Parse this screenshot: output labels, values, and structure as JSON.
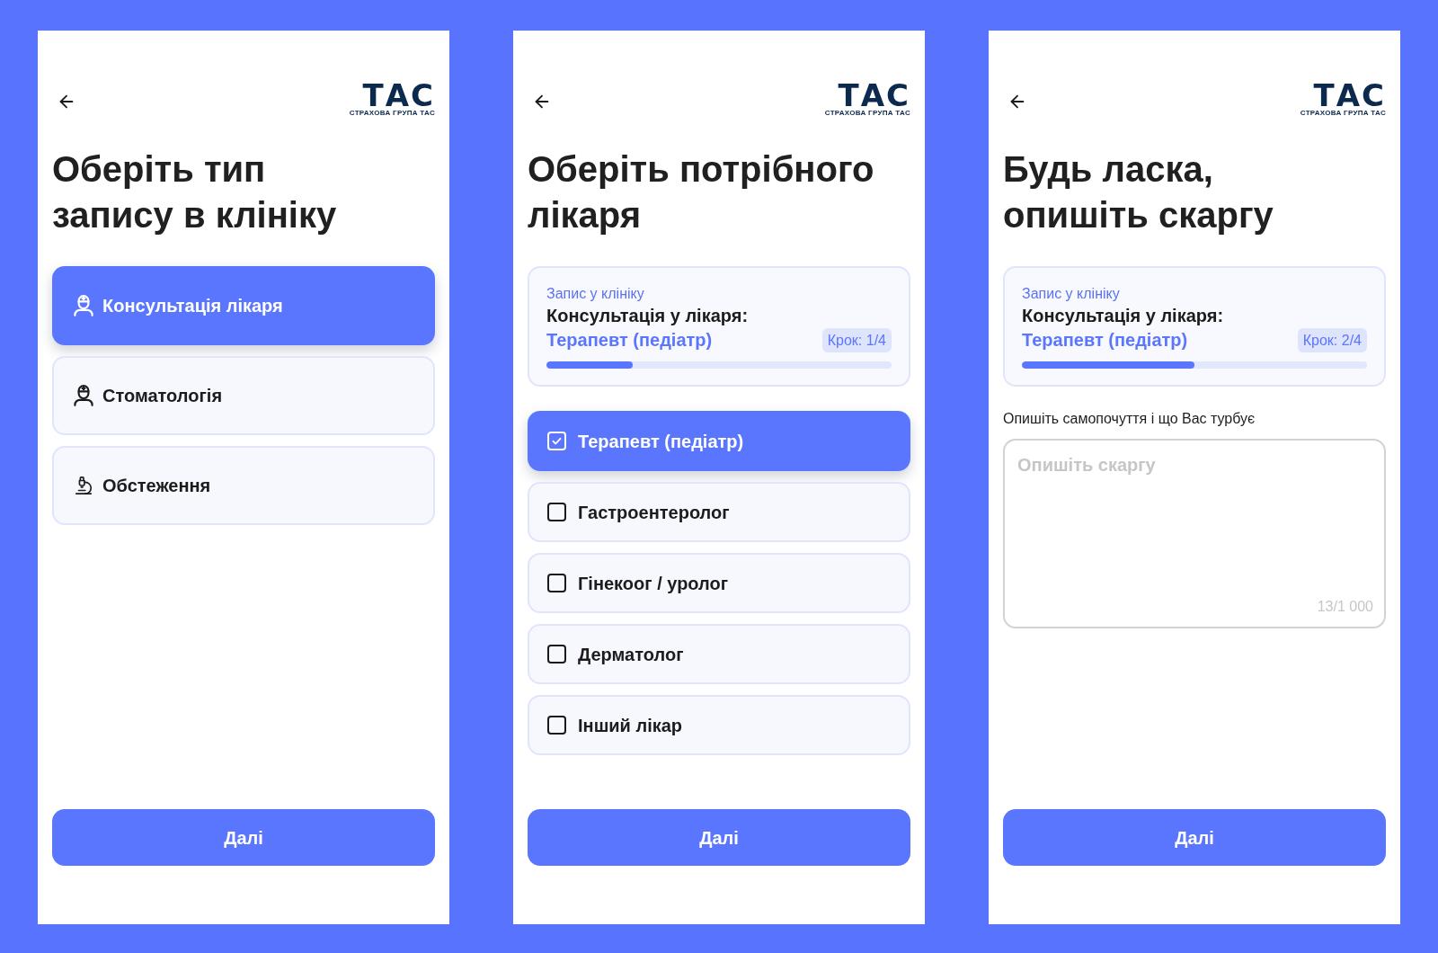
{
  "screens": [
    {
      "kind": "type_select",
      "logo": {
        "mark": "ТАС",
        "tagline": "СТРАХОВА ГРУПА ТАС"
      },
      "title_lines": [
        "Оберіть тип",
        "запису в клініку"
      ],
      "options": [
        {
          "label": "Консультація лікаря",
          "kind": "medic",
          "selected": true
        },
        {
          "label": "Стоматологія",
          "kind": "medic",
          "selected": false
        },
        {
          "label": "Обстеження",
          "kind": "microscope",
          "selected": false
        }
      ],
      "next_button": "Далі"
    },
    {
      "kind": "doctor_select",
      "logo": {
        "mark": "ТАС",
        "tagline": "СТРАХОВА ГРУПА ТАС"
      },
      "title_lines": [
        "Оберіть потрібного",
        "лікаря"
      ],
      "summary": {
        "caption": "Запис у клініку",
        "service": "Консультація у лікаря:",
        "choice": "Терапевт (педіатр)",
        "step": "Крок: 1/4",
        "level": 0.25
      },
      "options": [
        {
          "label": "Терапевт (педіатр)",
          "selected": true
        },
        {
          "label": "Гастроентеролог",
          "selected": false
        },
        {
          "label": "Гінекоог / уролог",
          "selected": false
        },
        {
          "label": "Дерматолог",
          "selected": false
        },
        {
          "label": "Інший лікар",
          "selected": false
        }
      ],
      "next_button": "Далі"
    },
    {
      "kind": "complaint",
      "logo": {
        "mark": "ТАС",
        "tagline": "СТРАХОВА ГРУПА ТАС"
      },
      "title_lines": [
        "Будь ласка,",
        "опишіть скаргу"
      ],
      "summary": {
        "caption": "Запис у клініку",
        "service": "Консультація у лікаря:",
        "choice": "Терапевт (педіатр)",
        "step": "Крок: 2/4",
        "level": 0.5
      },
      "field_label": "Опишіть самопочуття і що Вас турбує",
      "complaint_field": {
        "placeholder": "Опишіть скаргу",
        "counter": "13/1 000"
      },
      "next_button": "Далі"
    }
  ]
}
